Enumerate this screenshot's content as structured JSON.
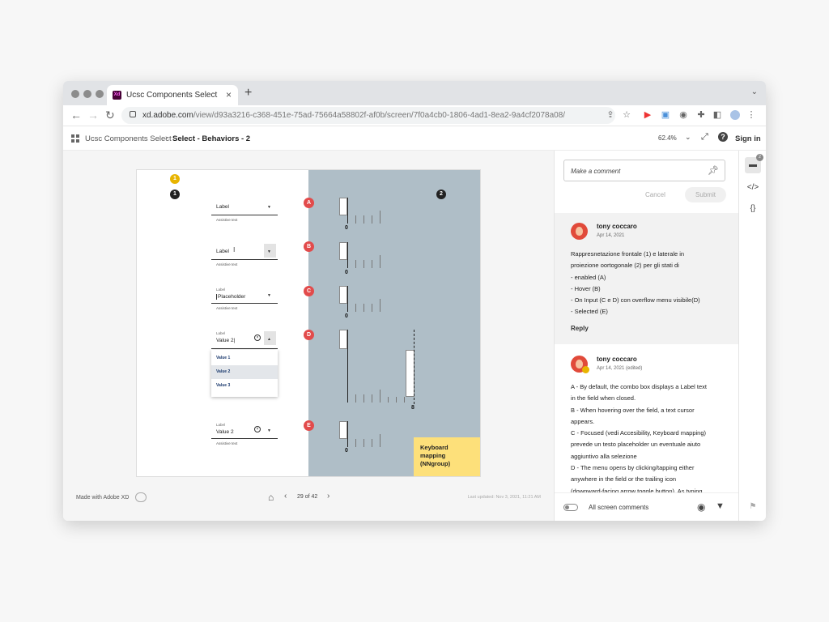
{
  "browser": {
    "tab_title": "Ucsc Components Select",
    "tab_icon_text": "Xd",
    "url_host": "xd.adobe.com",
    "url_path": "/view/d93a3216-c368-451e-75ad-75664a58802f-af0b/screen/7f0a4cb0-1806-4ad1-8ea2-9a4cf2078a08/"
  },
  "appbar": {
    "breadcrumb_root": "Ucsc Components Select",
    "breadcrumb_current": "Select - Behaviors - 2",
    "zoom": "62.4%",
    "signin": "Sign in",
    "help": "?"
  },
  "artboard": {
    "num_top": "1",
    "num_1": "1",
    "num_2": "2",
    "letters": [
      "A",
      "B",
      "C",
      "D",
      "E"
    ],
    "selects": {
      "a_label": "Label",
      "b_label": "Label",
      "c_small": "Label",
      "c_value": "Placeholder",
      "d_small": "Label",
      "d_value": "Value 2|",
      "e_small": "Label",
      "e_value": "Value 2",
      "assistive": "Assistive text"
    },
    "menu_items": [
      "Value 1",
      "Value 2",
      "Value 3"
    ],
    "zero_label": "0",
    "eight_label": "8",
    "keyboard_box": [
      "Keyboard",
      "mapping",
      "(NNgroup)"
    ]
  },
  "footer": {
    "made_with": "Made with Adobe XD",
    "page": "29 of 42",
    "updated": "Last updated: Nov 3, 2021, 11:21 AM"
  },
  "comments": {
    "placeholder": "Make a comment",
    "cancel": "Cancel",
    "submit": "Submit",
    "items": [
      {
        "author": "tony coccaro",
        "date": "Apr 14, 2021",
        "lines": [
          "Rappresnetazione frontale (1) e laterale in",
          "proiezione oortogonale  (2) per gli stati di",
          "- enabled (A)",
          "- Hover (B)",
          "- On Input (C e D) con overflow menu visibile(D)",
          "- Selected (E)"
        ],
        "reply": "Reply"
      },
      {
        "author": "tony coccaro",
        "date": "Apr 14, 2021 (edited)",
        "lines": [
          "A - By default, the combo box displays a Label text",
          "in the field when closed.",
          "B - When hovering over the field, a text cursor",
          "appears.",
          "C - Focused (vedi Accesibility, Keyboard mapping)",
          "prevede  un testo placeholder un eventuale aiuto",
          "aggiuntivo alla selezione",
          "D - The menu opens by clicking/tapping either",
          "anywhere in the field or the trailing icon",
          "(downward-facing arrow toggle button). As typing"
        ]
      }
    ],
    "all_screen": "All screen comments",
    "count": "2"
  }
}
